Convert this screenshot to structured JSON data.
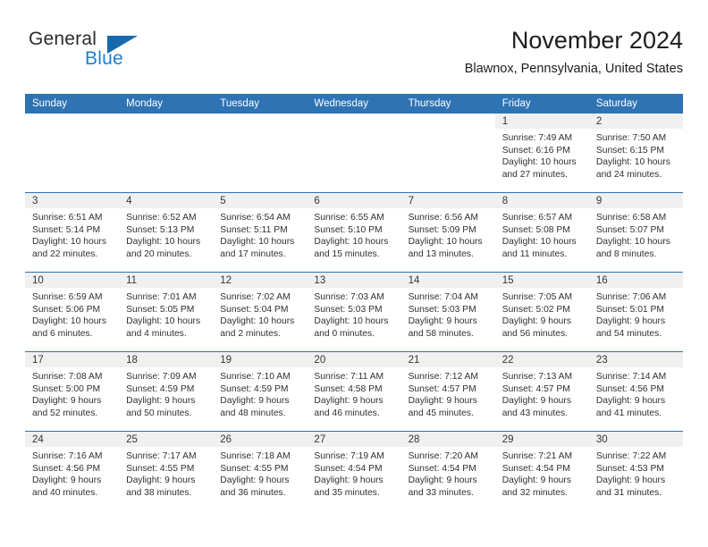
{
  "brand": {
    "name_top": "General",
    "name_bottom": "Blue",
    "flag_icon": "triangle-flag-icon",
    "accent_color": "#1f7fd0",
    "flag_color": "#1769ad"
  },
  "header": {
    "month_title": "November 2024",
    "location": "Blawnox, Pennsylvania, United States"
  },
  "calendar": {
    "header_color": "#2e73b4",
    "daynum_strip_color": "#f0f0f0",
    "weekday_headers": [
      "Sunday",
      "Monday",
      "Tuesday",
      "Wednesday",
      "Thursday",
      "Friday",
      "Saturday"
    ],
    "weeks": [
      [
        {
          "day": "",
          "blank": true,
          "sunrise": "",
          "sunset": "",
          "daylight_line1": "",
          "daylight_line2": ""
        },
        {
          "day": "",
          "blank": true,
          "sunrise": "",
          "sunset": "",
          "daylight_line1": "",
          "daylight_line2": ""
        },
        {
          "day": "",
          "blank": true,
          "sunrise": "",
          "sunset": "",
          "daylight_line1": "",
          "daylight_line2": ""
        },
        {
          "day": "",
          "blank": true,
          "sunrise": "",
          "sunset": "",
          "daylight_line1": "",
          "daylight_line2": ""
        },
        {
          "day": "",
          "blank": true,
          "sunrise": "",
          "sunset": "",
          "daylight_line1": "",
          "daylight_line2": ""
        },
        {
          "day": "1",
          "sunrise": "Sunrise: 7:49 AM",
          "sunset": "Sunset: 6:16 PM",
          "daylight_line1": "Daylight: 10 hours",
          "daylight_line2": "and 27 minutes."
        },
        {
          "day": "2",
          "sunrise": "Sunrise: 7:50 AM",
          "sunset": "Sunset: 6:15 PM",
          "daylight_line1": "Daylight: 10 hours",
          "daylight_line2": "and 24 minutes."
        }
      ],
      [
        {
          "day": "3",
          "sunrise": "Sunrise: 6:51 AM",
          "sunset": "Sunset: 5:14 PM",
          "daylight_line1": "Daylight: 10 hours",
          "daylight_line2": "and 22 minutes."
        },
        {
          "day": "4",
          "sunrise": "Sunrise: 6:52 AM",
          "sunset": "Sunset: 5:13 PM",
          "daylight_line1": "Daylight: 10 hours",
          "daylight_line2": "and 20 minutes."
        },
        {
          "day": "5",
          "sunrise": "Sunrise: 6:54 AM",
          "sunset": "Sunset: 5:11 PM",
          "daylight_line1": "Daylight: 10 hours",
          "daylight_line2": "and 17 minutes."
        },
        {
          "day": "6",
          "sunrise": "Sunrise: 6:55 AM",
          "sunset": "Sunset: 5:10 PM",
          "daylight_line1": "Daylight: 10 hours",
          "daylight_line2": "and 15 minutes."
        },
        {
          "day": "7",
          "sunrise": "Sunrise: 6:56 AM",
          "sunset": "Sunset: 5:09 PM",
          "daylight_line1": "Daylight: 10 hours",
          "daylight_line2": "and 13 minutes."
        },
        {
          "day": "8",
          "sunrise": "Sunrise: 6:57 AM",
          "sunset": "Sunset: 5:08 PM",
          "daylight_line1": "Daylight: 10 hours",
          "daylight_line2": "and 11 minutes."
        },
        {
          "day": "9",
          "sunrise": "Sunrise: 6:58 AM",
          "sunset": "Sunset: 5:07 PM",
          "daylight_line1": "Daylight: 10 hours",
          "daylight_line2": "and 8 minutes."
        }
      ],
      [
        {
          "day": "10",
          "sunrise": "Sunrise: 6:59 AM",
          "sunset": "Sunset: 5:06 PM",
          "daylight_line1": "Daylight: 10 hours",
          "daylight_line2": "and 6 minutes."
        },
        {
          "day": "11",
          "sunrise": "Sunrise: 7:01 AM",
          "sunset": "Sunset: 5:05 PM",
          "daylight_line1": "Daylight: 10 hours",
          "daylight_line2": "and 4 minutes."
        },
        {
          "day": "12",
          "sunrise": "Sunrise: 7:02 AM",
          "sunset": "Sunset: 5:04 PM",
          "daylight_line1": "Daylight: 10 hours",
          "daylight_line2": "and 2 minutes."
        },
        {
          "day": "13",
          "sunrise": "Sunrise: 7:03 AM",
          "sunset": "Sunset: 5:03 PM",
          "daylight_line1": "Daylight: 10 hours",
          "daylight_line2": "and 0 minutes."
        },
        {
          "day": "14",
          "sunrise": "Sunrise: 7:04 AM",
          "sunset": "Sunset: 5:03 PM",
          "daylight_line1": "Daylight: 9 hours",
          "daylight_line2": "and 58 minutes."
        },
        {
          "day": "15",
          "sunrise": "Sunrise: 7:05 AM",
          "sunset": "Sunset: 5:02 PM",
          "daylight_line1": "Daylight: 9 hours",
          "daylight_line2": "and 56 minutes."
        },
        {
          "day": "16",
          "sunrise": "Sunrise: 7:06 AM",
          "sunset": "Sunset: 5:01 PM",
          "daylight_line1": "Daylight: 9 hours",
          "daylight_line2": "and 54 minutes."
        }
      ],
      [
        {
          "day": "17",
          "sunrise": "Sunrise: 7:08 AM",
          "sunset": "Sunset: 5:00 PM",
          "daylight_line1": "Daylight: 9 hours",
          "daylight_line2": "and 52 minutes."
        },
        {
          "day": "18",
          "sunrise": "Sunrise: 7:09 AM",
          "sunset": "Sunset: 4:59 PM",
          "daylight_line1": "Daylight: 9 hours",
          "daylight_line2": "and 50 minutes."
        },
        {
          "day": "19",
          "sunrise": "Sunrise: 7:10 AM",
          "sunset": "Sunset: 4:59 PM",
          "daylight_line1": "Daylight: 9 hours",
          "daylight_line2": "and 48 minutes."
        },
        {
          "day": "20",
          "sunrise": "Sunrise: 7:11 AM",
          "sunset": "Sunset: 4:58 PM",
          "daylight_line1": "Daylight: 9 hours",
          "daylight_line2": "and 46 minutes."
        },
        {
          "day": "21",
          "sunrise": "Sunrise: 7:12 AM",
          "sunset": "Sunset: 4:57 PM",
          "daylight_line1": "Daylight: 9 hours",
          "daylight_line2": "and 45 minutes."
        },
        {
          "day": "22",
          "sunrise": "Sunrise: 7:13 AM",
          "sunset": "Sunset: 4:57 PM",
          "daylight_line1": "Daylight: 9 hours",
          "daylight_line2": "and 43 minutes."
        },
        {
          "day": "23",
          "sunrise": "Sunrise: 7:14 AM",
          "sunset": "Sunset: 4:56 PM",
          "daylight_line1": "Daylight: 9 hours",
          "daylight_line2": "and 41 minutes."
        }
      ],
      [
        {
          "day": "24",
          "sunrise": "Sunrise: 7:16 AM",
          "sunset": "Sunset: 4:56 PM",
          "daylight_line1": "Daylight: 9 hours",
          "daylight_line2": "and 40 minutes."
        },
        {
          "day": "25",
          "sunrise": "Sunrise: 7:17 AM",
          "sunset": "Sunset: 4:55 PM",
          "daylight_line1": "Daylight: 9 hours",
          "daylight_line2": "and 38 minutes."
        },
        {
          "day": "26",
          "sunrise": "Sunrise: 7:18 AM",
          "sunset": "Sunset: 4:55 PM",
          "daylight_line1": "Daylight: 9 hours",
          "daylight_line2": "and 36 minutes."
        },
        {
          "day": "27",
          "sunrise": "Sunrise: 7:19 AM",
          "sunset": "Sunset: 4:54 PM",
          "daylight_line1": "Daylight: 9 hours",
          "daylight_line2": "and 35 minutes."
        },
        {
          "day": "28",
          "sunrise": "Sunrise: 7:20 AM",
          "sunset": "Sunset: 4:54 PM",
          "daylight_line1": "Daylight: 9 hours",
          "daylight_line2": "and 33 minutes."
        },
        {
          "day": "29",
          "sunrise": "Sunrise: 7:21 AM",
          "sunset": "Sunset: 4:54 PM",
          "daylight_line1": "Daylight: 9 hours",
          "daylight_line2": "and 32 minutes."
        },
        {
          "day": "30",
          "sunrise": "Sunrise: 7:22 AM",
          "sunset": "Sunset: 4:53 PM",
          "daylight_line1": "Daylight: 9 hours",
          "daylight_line2": "and 31 minutes."
        }
      ]
    ]
  }
}
